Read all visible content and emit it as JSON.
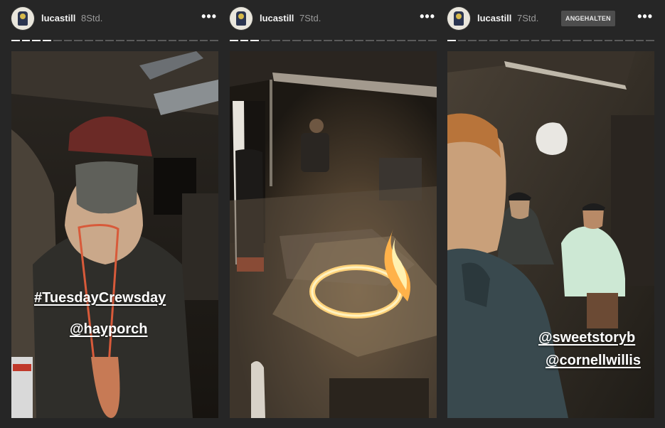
{
  "stories": [
    {
      "username": "lucastill",
      "time": "8Std.",
      "progress_segments": 20,
      "progress_done": 4,
      "captions": [
        "#TuesdayCrewsday",
        "@hayporch"
      ]
    },
    {
      "username": "lucastill",
      "time": "7Std.",
      "progress_segments": 20,
      "progress_done": 3,
      "captions": []
    },
    {
      "username": "lucastill",
      "time": "7Std.",
      "badge": "ANGEHALTEN",
      "progress_segments": 20,
      "progress_done": 1,
      "captions": [
        "@sweetstoryb",
        "@cornellwillis"
      ]
    }
  ],
  "more_icon": "•••",
  "colors": {
    "background": "#262626",
    "progress_done": "#f2f2f2",
    "progress_todo": "#5a5a5a"
  }
}
